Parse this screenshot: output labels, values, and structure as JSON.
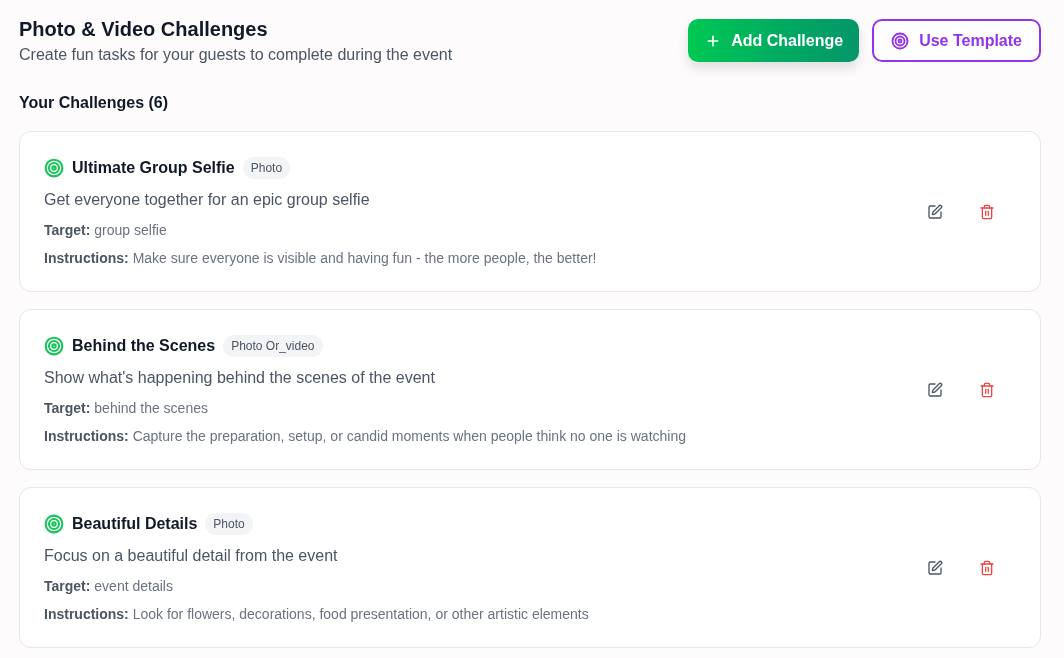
{
  "header": {
    "title": "Photo & Video Challenges",
    "subtitle": "Create fun tasks for your guests to complete during the event",
    "buttons": [
      {
        "kind": "primary",
        "label": "Add Challenge"
      },
      {
        "kind": "outline",
        "label": "Use Template"
      }
    ]
  },
  "section_title": "Your Challenges (6)",
  "challenges": [
    {
      "title": "Ultimate Group Selfie",
      "type": "Photo",
      "description": "Get everyone together for an epic group selfie",
      "target": "**Target:** group selfie",
      "instructions": "**Instructions:** Make sure everyone is visible and having fun - the more people, the better!"
    },
    {
      "title": "Behind the Scenes",
      "type": "Photo Or_video",
      "description": "Show what's happening behind the scenes of the event",
      "target": "**Target:** behind the scenes",
      "instructions": "**Instructions:** Capture the preparation, setup, or candid moments when people think no one is watching"
    },
    {
      "title": "Beautiful Details",
      "type": "Photo",
      "description": "Focus on a beautiful detail from the event",
      "target": "**Target:** event details",
      "instructions": "**Instructions:** Look for flowers, decorations, food presentation, or other artistic elements"
    }
  ]
}
